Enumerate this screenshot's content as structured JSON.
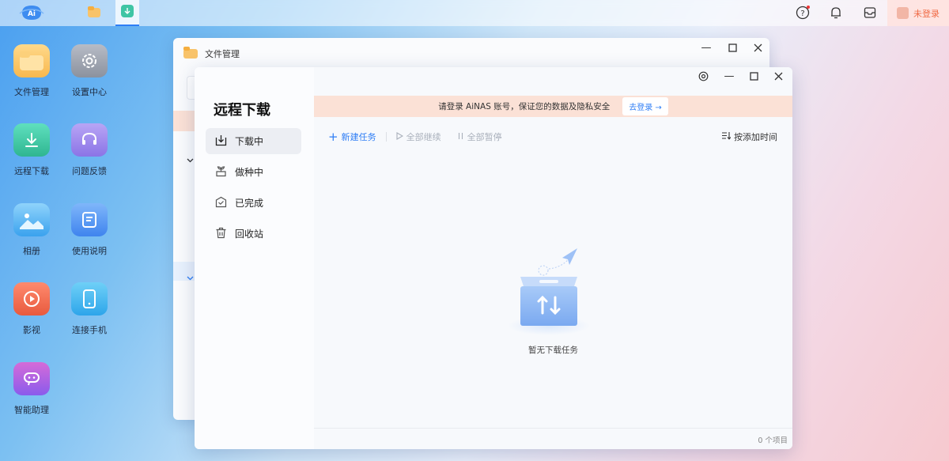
{
  "taskbar": {
    "logo_text": "Ai",
    "login_label": "未登录"
  },
  "desktop": {
    "icons": [
      {
        "label": "文件管理"
      },
      {
        "label": "设置中心"
      },
      {
        "label": "远程下载"
      },
      {
        "label": "问题反馈"
      },
      {
        "label": "相册"
      },
      {
        "label": "使用说明"
      },
      {
        "label": "影视"
      },
      {
        "label": "连接手机"
      },
      {
        "label": "智能助理"
      }
    ]
  },
  "file_window": {
    "title": "文件管理"
  },
  "download_window": {
    "title": "远程下载",
    "nav": [
      {
        "label": "下载中"
      },
      {
        "label": "做种中"
      },
      {
        "label": "已完成"
      },
      {
        "label": "回收站"
      }
    ],
    "banner": {
      "text": "请登录 AiNAS 账号，保证您的数据及隐私安全",
      "button": "去登录 →"
    },
    "toolbar": {
      "new_task": "新建任务",
      "resume_all": "全部继续",
      "pause_all": "全部暂停",
      "sort": "按添加时间"
    },
    "empty_text": "暂无下载任务",
    "footer_count": "0 个项目"
  },
  "colors": {
    "accent": "#2f7ef5",
    "banner_bg": "#fbe1d6",
    "login_text": "#f06a45"
  }
}
